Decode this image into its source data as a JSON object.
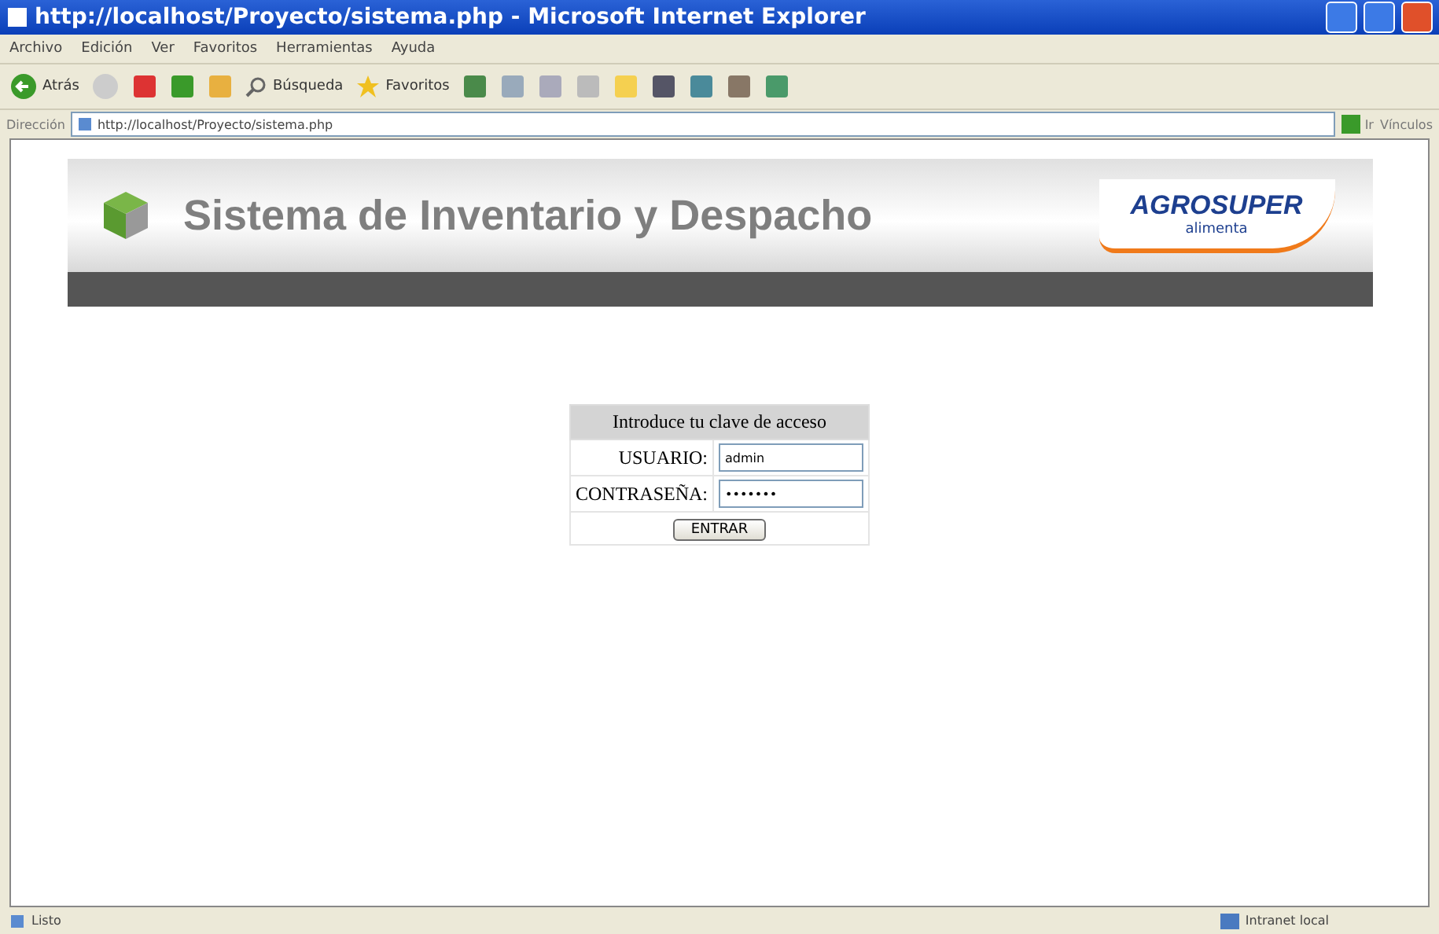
{
  "window": {
    "title": "http://localhost/Proyecto/sistema.php - Microsoft Internet Explorer"
  },
  "menu": [
    "Archivo",
    "Edición",
    "Ver",
    "Favoritos",
    "Herramientas",
    "Ayuda"
  ],
  "toolbar": {
    "back": "Atrás",
    "search": "Búsqueda",
    "favorites": "Favoritos"
  },
  "address_bar": {
    "label": "Dirección",
    "value": "http://localhost/Proyecto/sistema.php",
    "go": "Ir",
    "links": "Vínculos"
  },
  "header": {
    "title": "Sistema de Inventario y Despacho",
    "logo_text": "AGROSUPER",
    "logo_tagline": "alimenta"
  },
  "login": {
    "heading": "Introduce tu clave de acceso",
    "fields": [
      {
        "label": "USUARIO:",
        "value": "admin"
      },
      {
        "label": "CONTRASEÑA:",
        "value": "•••••••"
      }
    ],
    "button": "ENTRAR"
  },
  "status_bar": {
    "left": "Listo",
    "zone": "Intranet local"
  }
}
